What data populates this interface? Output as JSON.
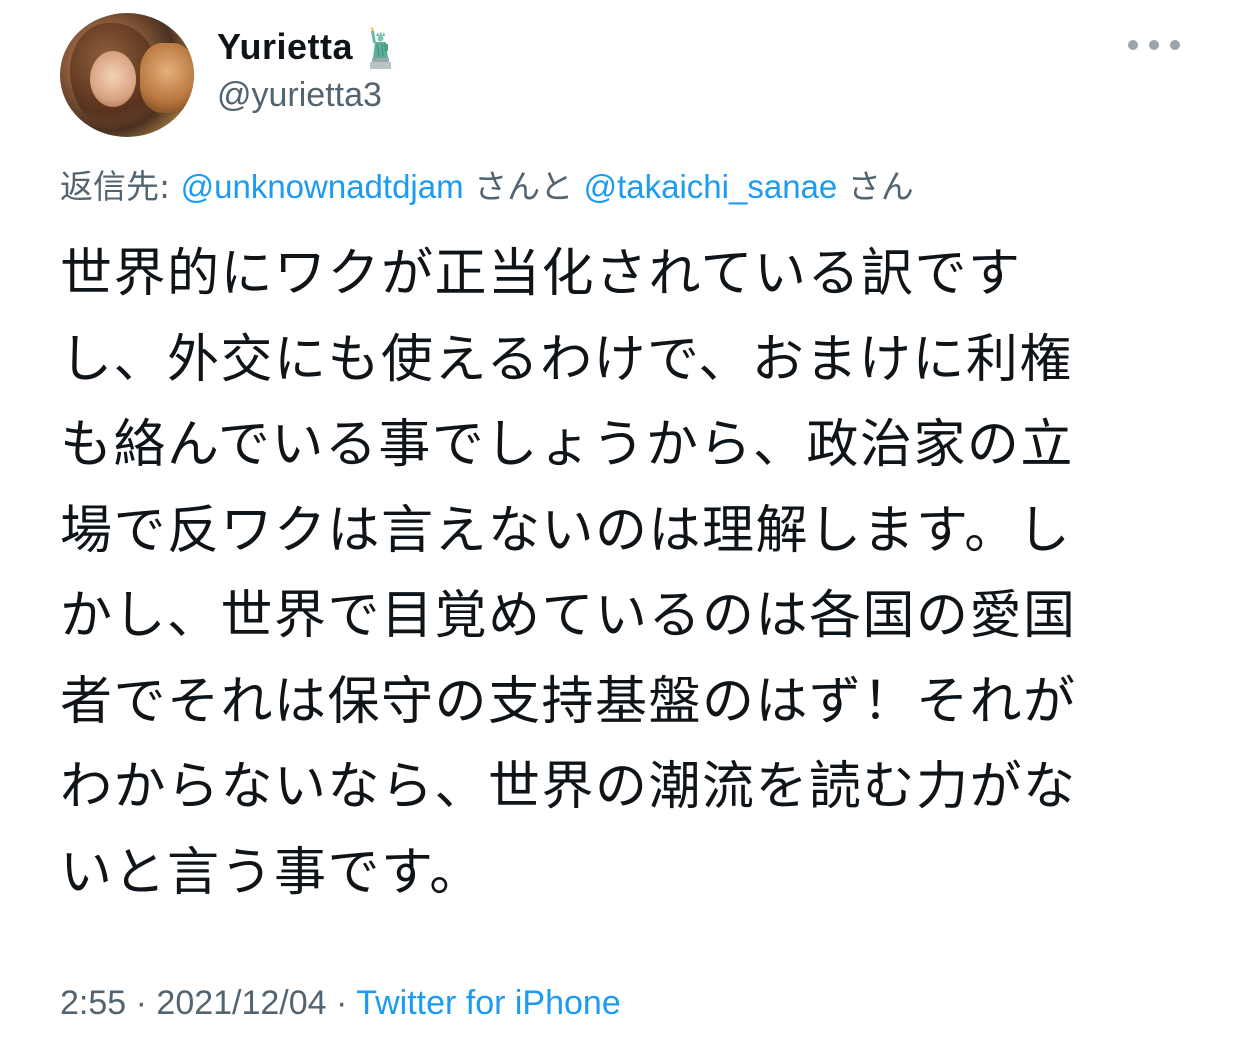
{
  "tweet": {
    "author": {
      "display_name": "Yurietta",
      "handle": "@yurietta3",
      "badge_icon": "statue-of-liberty-icon"
    },
    "reply_to": {
      "prefix": "返信先: ",
      "mention1": "@unknownadtdjam",
      "joiner": " さんと ",
      "mention2": "@takaichi_sanae",
      "suffix": " さん"
    },
    "body_lines": [
      "世界的にワクが正当化されている訳です",
      "し、外交にも使えるわけで、おまけに利権",
      "も絡んでいる事でしょうから、政治家の立",
      "場で反ワクは言えないのは理解します。し",
      "かし、世界で目覚めているのは各国の愛国",
      "者でそれは保守の支持基盤のはず！それが",
      "わからないなら、世界の潮流を読む力がな",
      "いと言う事です。"
    ],
    "meta": {
      "time": "2:55",
      "sep1": " · ",
      "date": "2021/12/04",
      "sep2": " · ",
      "source": "Twitter for iPhone"
    }
  },
  "colors": {
    "text": "#0f1419",
    "secondary": "#536471",
    "link": "#1d9bf0"
  }
}
